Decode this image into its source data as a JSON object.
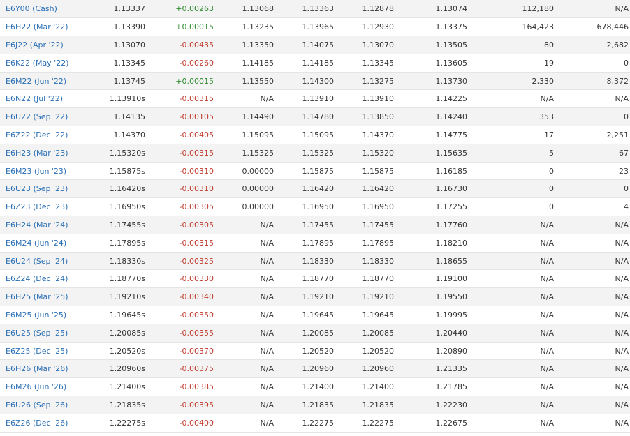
{
  "rows": [
    {
      "symbol": "E6Y00 (Cash)",
      "last": "1.13337",
      "change": "+0.00263",
      "open": "1.13068",
      "high": "1.13363",
      "low": "1.12878",
      "previous": "1.13074",
      "volume": "112,180",
      "open_int": "N/A"
    },
    {
      "symbol": "E6H22 (Mar '22)",
      "last": "1.13390",
      "change": "+0.00015",
      "open": "1.13235",
      "high": "1.13965",
      "low": "1.12930",
      "previous": "1.13375",
      "volume": "164,423",
      "open_int": "678,446"
    },
    {
      "symbol": "E6J22 (Apr '22)",
      "last": "1.13070",
      "change": "-0.00435",
      "open": "1.13350",
      "high": "1.14075",
      "low": "1.13070",
      "previous": "1.13505",
      "volume": "80",
      "open_int": "2,682"
    },
    {
      "symbol": "E6K22 (May '22)",
      "last": "1.13345",
      "change": "-0.00260",
      "open": "1.14185",
      "high": "1.14185",
      "low": "1.13345",
      "previous": "1.13605",
      "volume": "19",
      "open_int": "0"
    },
    {
      "symbol": "E6M22 (Jun '22)",
      "last": "1.13745",
      "change": "+0.00015",
      "open": "1.13550",
      "high": "1.14300",
      "low": "1.13275",
      "previous": "1.13730",
      "volume": "2,330",
      "open_int": "8,372"
    },
    {
      "symbol": "E6N22 (Jul '22)",
      "last": "1.13910s",
      "change": "-0.00315",
      "open": "N/A",
      "high": "1.13910",
      "low": "1.13910",
      "previous": "1.14225",
      "volume": "N/A",
      "open_int": "N/A"
    },
    {
      "symbol": "E6U22 (Sep '22)",
      "last": "1.14135",
      "change": "-0.00105",
      "open": "1.14490",
      "high": "1.14780",
      "low": "1.13850",
      "previous": "1.14240",
      "volume": "353",
      "open_int": "0"
    },
    {
      "symbol": "E6Z22 (Dec '22)",
      "last": "1.14370",
      "change": "-0.00405",
      "open": "1.15095",
      "high": "1.15095",
      "low": "1.14370",
      "previous": "1.14775",
      "volume": "17",
      "open_int": "2,251"
    },
    {
      "symbol": "E6H23 (Mar '23)",
      "last": "1.15320s",
      "change": "-0.00315",
      "open": "1.15325",
      "high": "1.15325",
      "low": "1.15320",
      "previous": "1.15635",
      "volume": "5",
      "open_int": "67"
    },
    {
      "symbol": "E6M23 (Jun '23)",
      "last": "1.15875s",
      "change": "-0.00310",
      "open": "0.00000",
      "high": "1.15875",
      "low": "1.15875",
      "previous": "1.16185",
      "volume": "0",
      "open_int": "23"
    },
    {
      "symbol": "E6U23 (Sep '23)",
      "last": "1.16420s",
      "change": "-0.00310",
      "open": "0.00000",
      "high": "1.16420",
      "low": "1.16420",
      "previous": "1.16730",
      "volume": "0",
      "open_int": "0"
    },
    {
      "symbol": "E6Z23 (Dec '23)",
      "last": "1.16950s",
      "change": "-0.00305",
      "open": "0.00000",
      "high": "1.16950",
      "low": "1.16950",
      "previous": "1.17255",
      "volume": "0",
      "open_int": "4"
    },
    {
      "symbol": "E6H24 (Mar '24)",
      "last": "1.17455s",
      "change": "-0.00305",
      "open": "N/A",
      "high": "1.17455",
      "low": "1.17455",
      "previous": "1.17760",
      "volume": "N/A",
      "open_int": "N/A"
    },
    {
      "symbol": "E6M24 (Jun '24)",
      "last": "1.17895s",
      "change": "-0.00315",
      "open": "N/A",
      "high": "1.17895",
      "low": "1.17895",
      "previous": "1.18210",
      "volume": "N/A",
      "open_int": "N/A"
    },
    {
      "symbol": "E6U24 (Sep '24)",
      "last": "1.18330s",
      "change": "-0.00325",
      "open": "N/A",
      "high": "1.18330",
      "low": "1.18330",
      "previous": "1.18655",
      "volume": "N/A",
      "open_int": "N/A"
    },
    {
      "symbol": "E6Z24 (Dec '24)",
      "last": "1.18770s",
      "change": "-0.00330",
      "open": "N/A",
      "high": "1.18770",
      "low": "1.18770",
      "previous": "1.19100",
      "volume": "N/A",
      "open_int": "N/A"
    },
    {
      "symbol": "E6H25 (Mar '25)",
      "last": "1.19210s",
      "change": "-0.00340",
      "open": "N/A",
      "high": "1.19210",
      "low": "1.19210",
      "previous": "1.19550",
      "volume": "N/A",
      "open_int": "N/A"
    },
    {
      "symbol": "E6M25 (Jun '25)",
      "last": "1.19645s",
      "change": "-0.00350",
      "open": "N/A",
      "high": "1.19645",
      "low": "1.19645",
      "previous": "1.19995",
      "volume": "N/A",
      "open_int": "N/A"
    },
    {
      "symbol": "E6U25 (Sep '25)",
      "last": "1.20085s",
      "change": "-0.00355",
      "open": "N/A",
      "high": "1.20085",
      "low": "1.20085",
      "previous": "1.20440",
      "volume": "N/A",
      "open_int": "N/A"
    },
    {
      "symbol": "E6Z25 (Dec '25)",
      "last": "1.20520s",
      "change": "-0.00370",
      "open": "N/A",
      "high": "1.20520",
      "low": "1.20520",
      "previous": "1.20890",
      "volume": "N/A",
      "open_int": "N/A"
    },
    {
      "symbol": "E6H26 (Mar '26)",
      "last": "1.20960s",
      "change": "-0.00375",
      "open": "N/A",
      "high": "1.20960",
      "low": "1.20960",
      "previous": "1.21335",
      "volume": "N/A",
      "open_int": "N/A"
    },
    {
      "symbol": "E6M26 (Jun '26)",
      "last": "1.21400s",
      "change": "-0.00385",
      "open": "N/A",
      "high": "1.21400",
      "low": "1.21400",
      "previous": "1.21785",
      "volume": "N/A",
      "open_int": "N/A"
    },
    {
      "symbol": "E6U26 (Sep '26)",
      "last": "1.21835s",
      "change": "-0.00395",
      "open": "N/A",
      "high": "1.21835",
      "low": "1.21835",
      "previous": "1.22230",
      "volume": "N/A",
      "open_int": "N/A"
    },
    {
      "symbol": "E6Z26 (Dec '26)",
      "last": "1.22275s",
      "change": "-0.00400",
      "open": "N/A",
      "high": "1.22275",
      "low": "1.22275",
      "previous": "1.22675",
      "volume": "N/A",
      "open_int": "N/A"
    }
  ],
  "colors": {
    "link": "#2a6fb5",
    "positive": "#2e8b2e",
    "negative": "#c0392b",
    "stripe": "#f3f3f3"
  }
}
